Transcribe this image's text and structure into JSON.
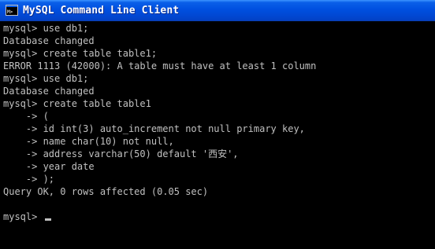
{
  "window": {
    "title": "MySQL Command Line Client",
    "icon": "console-window-icon"
  },
  "console": {
    "lines": [
      "mysql> use db1;",
      "Database changed",
      "mysql> create table table1;",
      "ERROR 1113 (42000): A table must have at least 1 column",
      "mysql> use db1;",
      "Database changed",
      "mysql> create table table1",
      "    -> (",
      "    -> id int(3) auto_increment not null primary key,",
      "    -> name char(10) not null,",
      "    -> address varchar(50) default '西安',",
      "    -> year date",
      "    -> );",
      "Query OK, 0 rows affected (0.05 sec)",
      "",
      "mysql> "
    ]
  },
  "colors": {
    "console_background": "#000000",
    "console_text": "#c0c0c0",
    "titlebar_blue": "#0050e0",
    "title_text": "#ffffff"
  }
}
